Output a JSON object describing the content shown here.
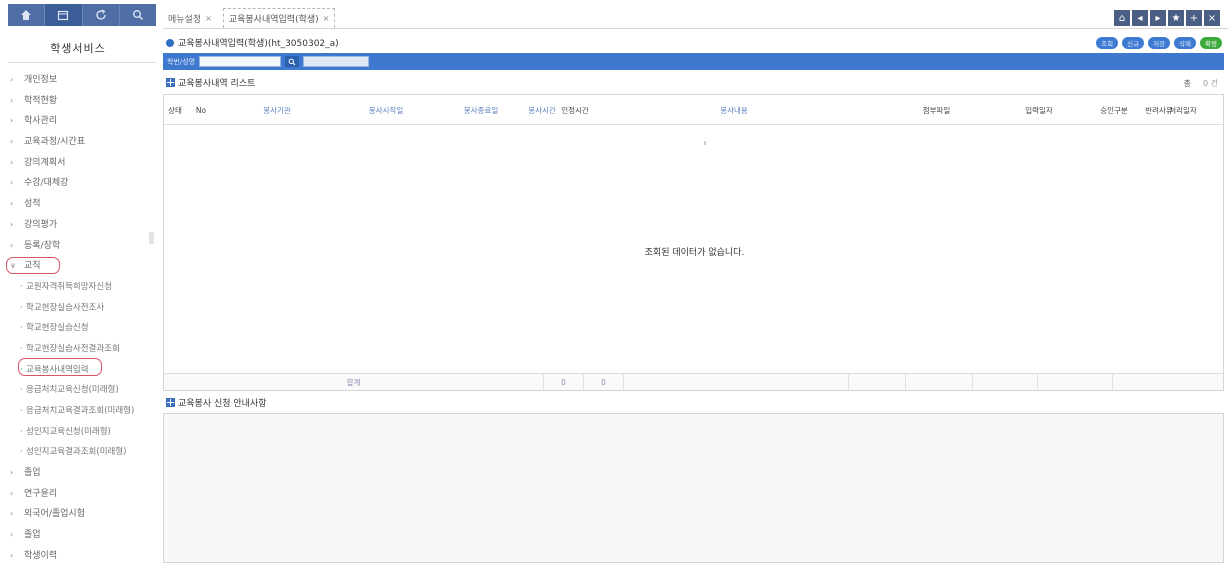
{
  "sidebar": {
    "title": "학생서비스",
    "tabs": [
      "home-icon",
      "calendar-icon",
      "refresh-icon",
      "search-icon"
    ],
    "menu": [
      {
        "label": "개인정보",
        "type": "top",
        "arrow": "›"
      },
      {
        "label": "학적현황",
        "type": "top",
        "arrow": "›"
      },
      {
        "label": "학사관리",
        "type": "top",
        "arrow": "›"
      },
      {
        "label": "교육과정/시간표",
        "type": "top",
        "arrow": "›"
      },
      {
        "label": "강의계획서",
        "type": "top",
        "arrow": "›"
      },
      {
        "label": "수강/대체강",
        "type": "top",
        "arrow": "›"
      },
      {
        "label": "성적",
        "type": "top",
        "arrow": "›"
      },
      {
        "label": "강의평가",
        "type": "top",
        "arrow": "›"
      },
      {
        "label": "등록/장학",
        "type": "top",
        "arrow": "›"
      },
      {
        "label": "교직",
        "type": "top",
        "arrow": "∨"
      },
      {
        "label": "교원자격취득희망자신청",
        "type": "sub"
      },
      {
        "label": "학교현장실습사전조사",
        "type": "sub"
      },
      {
        "label": "학교현장실습신청",
        "type": "sub"
      },
      {
        "label": "학교현장실습사전결과조회",
        "type": "sub"
      },
      {
        "label": "교육봉사내역입력",
        "type": "sub"
      },
      {
        "label": "응급처치교육신청(미래형)",
        "type": "sub"
      },
      {
        "label": "응급처치교육결과조회(미래형)",
        "type": "sub"
      },
      {
        "label": "성인지교육신청(미래형)",
        "type": "sub"
      },
      {
        "label": "성인지교육결과조회(미래형)",
        "type": "sub"
      },
      {
        "label": "졸업",
        "type": "top",
        "arrow": "›"
      },
      {
        "label": "연구윤리",
        "type": "top",
        "arrow": "›"
      },
      {
        "label": "외국어/졸업시험",
        "type": "top",
        "arrow": "›"
      },
      {
        "label": "졸업",
        "type": "top",
        "arrow": "›"
      },
      {
        "label": "학생이력",
        "type": "top",
        "arrow": "›"
      }
    ]
  },
  "tabbar": {
    "tabs": [
      {
        "label": "메뉴설정",
        "close": "×"
      },
      {
        "label": "교육봉사내역입력(학생)",
        "close": "×"
      }
    ],
    "icons": [
      "home-icon",
      "back-icon",
      "forward-icon",
      "star-icon",
      "plus-icon",
      "close-icon"
    ]
  },
  "page": {
    "title": "교육봉사내역입력(학생)(ht_3050302_a)",
    "actions": [
      {
        "label": "조회",
        "color": "blue"
      },
      {
        "label": "신규",
        "color": "blue"
      },
      {
        "label": "저장",
        "color": "blue"
      },
      {
        "label": "삭제",
        "color": "blue"
      },
      {
        "label": "확정",
        "color": "green"
      }
    ],
    "search": {
      "label": "학번/성명",
      "value": "",
      "value2": ""
    }
  },
  "list": {
    "title": "교육봉사내역 리스트",
    "total_label": "총",
    "total_count": "0 건",
    "columns": [
      {
        "label": "상태",
        "blue": false
      },
      {
        "label": "No",
        "blue": false
      },
      {
        "label": "봉사기관",
        "blue": true
      },
      {
        "label": "봉사\n시작일",
        "blue": true
      },
      {
        "label": "봉사\n종료일",
        "blue": true
      },
      {
        "label": "봉사\n시간",
        "blue": true
      },
      {
        "label": "인정\n시간",
        "blue": false
      },
      {
        "label": "봉사내용",
        "blue": true
      },
      {
        "label": "첨부파일",
        "blue": false
      },
      {
        "label": "입력일자",
        "blue": false
      },
      {
        "label": "승인구분",
        "blue": false
      },
      {
        "label": "처리일자",
        "blue": false
      },
      {
        "label": "반려사유",
        "blue": false
      }
    ],
    "empty_message": "조회된 데이터가 없습니다.",
    "footer": {
      "label": "합계",
      "sum1": "0",
      "sum2": "0"
    }
  },
  "notice": {
    "title": "교육봉사 신청 안내사항"
  }
}
